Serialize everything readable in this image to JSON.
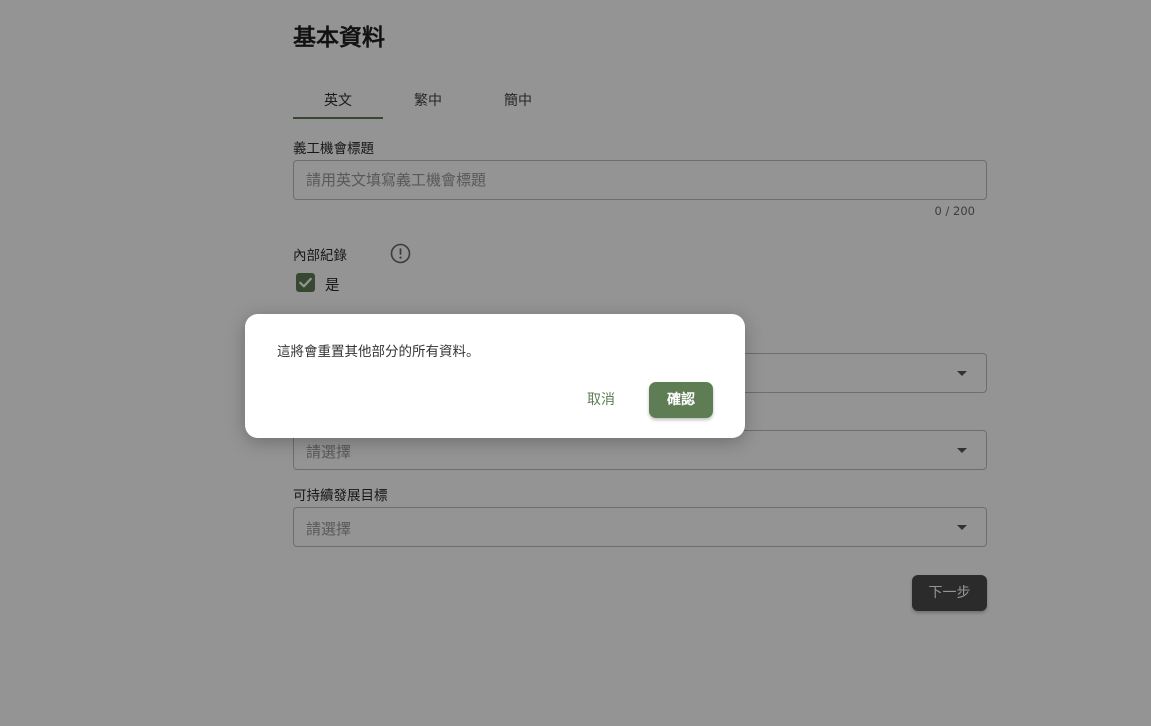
{
  "page": {
    "title": "基本資料"
  },
  "tabs": [
    {
      "label": "英文"
    },
    {
      "label": "繁中"
    },
    {
      "label": "簡中"
    }
  ],
  "form": {
    "title_field": {
      "label": "義工機會標題",
      "placeholder": "請用英文填寫義工機會標題",
      "value": "",
      "counter": "0 / 200"
    },
    "internal_record": {
      "label": "內部紀錄",
      "info_icon": "info-icon",
      "checkbox_label": "是",
      "checked": true
    },
    "select_one": {
      "placeholder": ""
    },
    "select_two": {
      "placeholder": "請選擇"
    },
    "sdg": {
      "label": "可持續發展目標",
      "placeholder": "請選擇"
    },
    "next_label": "下一步"
  },
  "dialog": {
    "message": "這將會重置其他部分的所有資料。",
    "cancel_label": "取消",
    "confirm_label": "確認"
  },
  "colors": {
    "accent": "#5e7d55",
    "overlay": "rgba(0,0,0,0.42)"
  }
}
